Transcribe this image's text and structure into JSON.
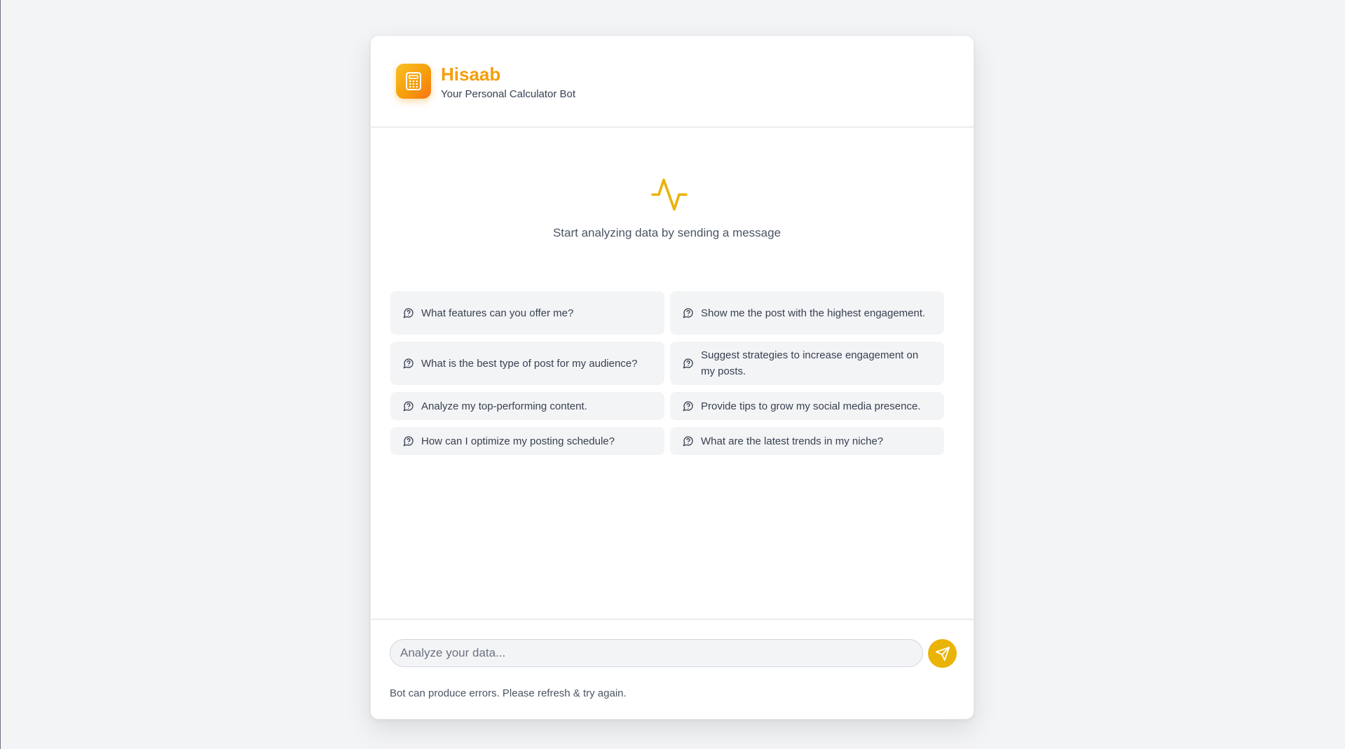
{
  "app": {
    "title": "Hisaab",
    "subtitle": "Your Personal Calculator Bot",
    "accent": "#f59e0b",
    "logo_icon": "calculator-icon"
  },
  "empty_state": {
    "icon": "activity-pulse-icon",
    "message": "Start analyzing data by sending a message"
  },
  "suggestions": [
    {
      "text": "What features can you offer me?",
      "icon": "message-circle-question-icon"
    },
    {
      "text": "Show me the post with the highest engagement.",
      "icon": "message-circle-question-icon"
    },
    {
      "text": "What is the best type of post for my audience?",
      "icon": "message-circle-question-icon"
    },
    {
      "text": "Suggest strategies to increase engagement on my posts.",
      "icon": "message-circle-question-icon"
    },
    {
      "text": "Analyze my top-performing content.",
      "icon": "message-circle-question-icon"
    },
    {
      "text": "Provide tips to grow my social media presence.",
      "icon": "message-circle-question-icon"
    },
    {
      "text": "How can I optimize my posting schedule?",
      "icon": "message-circle-question-icon"
    },
    {
      "text": "What are the latest trends in my niche?",
      "icon": "message-circle-question-icon"
    }
  ],
  "composer": {
    "placeholder": "Analyze your data...",
    "value": "",
    "send_icon": "send-icon",
    "send_color": "#eab308"
  },
  "disclaimer": "Bot can produce errors. Please refresh & try again."
}
